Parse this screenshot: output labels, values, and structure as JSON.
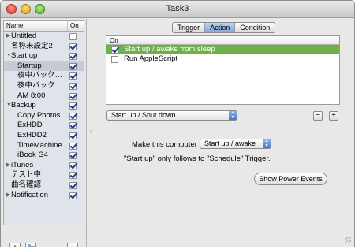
{
  "window": {
    "title": "Task3"
  },
  "sidebar": {
    "header_name": "Name",
    "header_on": "On",
    "items": [
      {
        "label": "Untitled",
        "indent": 0,
        "disclosure": "▶",
        "checked": false,
        "selected": false
      },
      {
        "label": "名称未設定2",
        "indent": 0,
        "disclosure": "",
        "checked": true,
        "selected": false
      },
      {
        "label": "Start up",
        "indent": 0,
        "disclosure": "▼",
        "checked": true,
        "selected": false
      },
      {
        "label": "Startup",
        "indent": 1,
        "disclosure": "",
        "checked": true,
        "selected": true
      },
      {
        "label": "夜中バック…",
        "indent": 1,
        "disclosure": "",
        "checked": true,
        "selected": false
      },
      {
        "label": "夜中バック…",
        "indent": 1,
        "disclosure": "",
        "checked": true,
        "selected": false
      },
      {
        "label": "AM 8:00",
        "indent": 1,
        "disclosure": "",
        "checked": true,
        "selected": false
      },
      {
        "label": "Backup",
        "indent": 0,
        "disclosure": "▼",
        "checked": true,
        "selected": false
      },
      {
        "label": "Copy Photos",
        "indent": 1,
        "disclosure": "",
        "checked": true,
        "selected": false
      },
      {
        "label": "ExHDD",
        "indent": 1,
        "disclosure": "",
        "checked": true,
        "selected": false
      },
      {
        "label": "ExHDD2",
        "indent": 1,
        "disclosure": "",
        "checked": true,
        "selected": false
      },
      {
        "label": "TimeMachine",
        "indent": 1,
        "disclosure": "",
        "checked": true,
        "selected": false
      },
      {
        "label": "iBook G4",
        "indent": 1,
        "disclosure": "",
        "checked": true,
        "selected": false
      },
      {
        "label": "iTunes",
        "indent": 0,
        "disclosure": "▶",
        "checked": true,
        "selected": false
      },
      {
        "label": "テスト中",
        "indent": 0,
        "disclosure": "",
        "checked": true,
        "selected": false
      },
      {
        "label": "曲名確認",
        "indent": 0,
        "disclosure": "",
        "checked": true,
        "selected": false
      },
      {
        "label": "Notification",
        "indent": 0,
        "disclosure": "▶",
        "checked": true,
        "selected": false
      }
    ],
    "add_label": "+",
    "remove_label": "−"
  },
  "tabs": [
    {
      "label": "Trigger",
      "active": false
    },
    {
      "label": "Action",
      "active": true
    },
    {
      "label": "Condition",
      "active": false
    }
  ],
  "actions": {
    "header_on": "On",
    "rows": [
      {
        "label": "Start up / awake from sleep",
        "checked": true,
        "selected": true
      },
      {
        "label": "Run AppleScript",
        "checked": false,
        "selected": false
      }
    ],
    "type_popup": "Start up / Shut down",
    "remove_label": "−",
    "add_label": "+"
  },
  "settings": {
    "make_label": "Make this computer",
    "make_value": "Start up / awake",
    "note": "\"Start up\" only follows to \"Schedule\" Trigger.",
    "power_button": "Show Power Events"
  },
  "colors": {
    "selection_green": "#6eb04a",
    "tab_blue": "#7fa7d8"
  }
}
